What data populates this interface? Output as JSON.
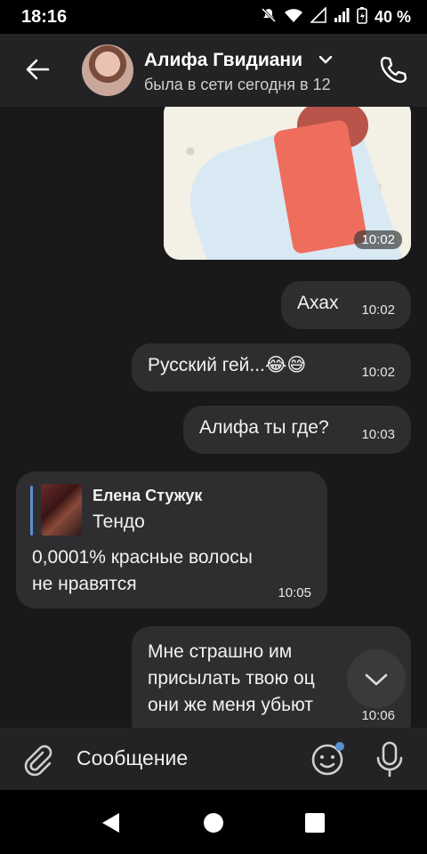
{
  "status_bar": {
    "time": "18:16",
    "battery": "40 %"
  },
  "header": {
    "contact_name": "Алифа Гвидиани",
    "last_seen": "была в сети сегодня в 12"
  },
  "messages": [
    {
      "type": "image",
      "time": "10:02"
    },
    {
      "text": "Ахах",
      "time": "10:02"
    },
    {
      "text": "Русский гей...😂😅",
      "time": "10:02"
    },
    {
      "text": "Алифа ты где?",
      "time": "10:03"
    },
    {
      "reply_author": "Елена Стужук",
      "reply_text": "Тендо",
      "line1": "0,0001% красные волосы",
      "line2": "не нравятся",
      "time": "10:05"
    },
    {
      "line1": "Мне страшно им",
      "line2": "присылать твою оц",
      "line3": "они же меня убьют",
      "time": "10:06"
    }
  ],
  "composer": {
    "placeholder": "Сообщение"
  },
  "colors": {
    "accent": "#5a8fd0",
    "bubble": "#2e2e30",
    "header": "#232325"
  }
}
